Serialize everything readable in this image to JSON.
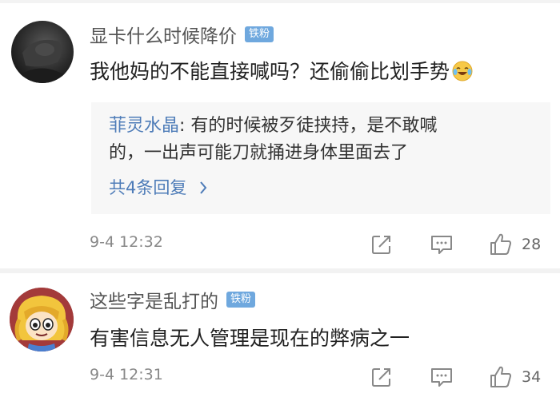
{
  "comments": [
    {
      "username": "显卡什么时候降价",
      "badge": "铁粉",
      "text": "我他妈的不能直接喊吗？还偷偷比划手势",
      "emoji_icon": "laughing-tears-emoji",
      "reply_preview": {
        "author": "菲灵水晶",
        "separator": ": ",
        "text_line1": "有的时候被歹徒挟持，是不敢喊",
        "text_line2": "的，一出声可能刀就捅进身体里面去了",
        "more_label": "共4条回复",
        "more_icon": "chevron-right-icon"
      },
      "time": "9-4 12:32",
      "likes": "28"
    },
    {
      "username": "这些字是乱打的",
      "badge": "铁粉",
      "text": "有害信息无人管理是现在的弊病之一",
      "time": "9-4 12:31",
      "likes": "34"
    }
  ],
  "colors": {
    "badge": "#6fa8de",
    "link": "#4e7cb8",
    "reply_bg": "#f7f7f7",
    "meta": "#888888"
  },
  "icons": [
    "repost-icon",
    "comment-icon",
    "thumbs-up-icon"
  ]
}
